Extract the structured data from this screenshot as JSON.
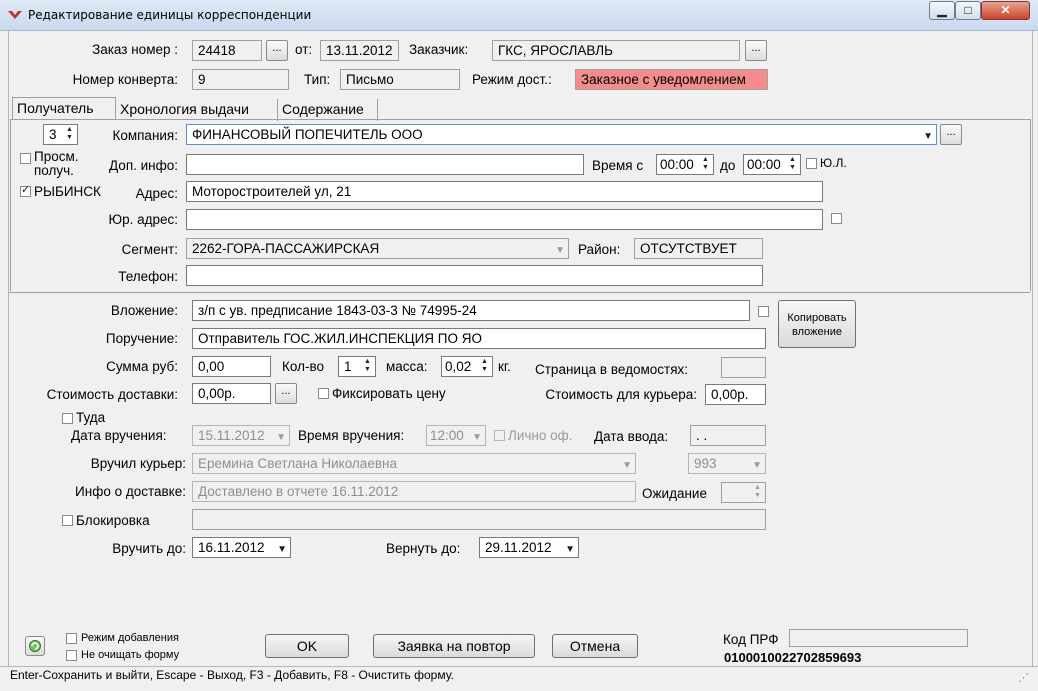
{
  "window": {
    "title": "Редактирование единицы корреспонденции",
    "min_glyph": "▁",
    "max_glyph": "□",
    "close_glyph": "✕"
  },
  "header": {
    "order_label": "Заказ номер :",
    "order_value": "24418",
    "from_label": "от:",
    "from_value": "13.11.2012",
    "customer_label": "Заказчик:",
    "customer_value": "ГКС, ЯРОСЛАВЛЬ",
    "envelope_label": "Номер конверта:",
    "envelope_value": "9",
    "type_label": "Тип:",
    "type_value": "Письмо",
    "delivery_mode_label": "Режим дост.:",
    "delivery_mode_value": "Заказное с уведомлением",
    "dots": "..."
  },
  "tabs": [
    "Получатель",
    "Хронология выдачи",
    "Содержание"
  ],
  "recipient": {
    "spin_value": "3",
    "company_label": "Компания:",
    "company_value": "ФИНАНСОВЫЙ ПОПЕЧИТЕЛЬ ООО",
    "view_label_1": "Просм.",
    "view_label_2": "получ.",
    "extra_info_label": "Доп. инфо:",
    "extra_info_value": "",
    "time_from_label": "Время с",
    "time_from_value": "00:00",
    "time_to_label": "до",
    "time_to_value": "00:00",
    "legal_label": "Ю.Л.",
    "city_label": "РЫБИНСК",
    "address_label": "Адрес:",
    "address_value": "Моторостроителей ул, 21",
    "legal_address_label": "Юр. адрес:",
    "legal_address_value": "",
    "segment_label": "Сегмент:",
    "segment_value": "2262-ГОРА-ПАССАЖИРСКАЯ",
    "district_label": "Район:",
    "district_value": "ОТСУТСТВУЕТ",
    "phone_label": "Телефон:",
    "phone_value": ""
  },
  "content": {
    "attachment_label": "Вложение:",
    "attachment_value": "з/п с ув. предписание 1843-03-3  № 74995-24",
    "copy_button_1": "Копировать",
    "copy_button_2": "вложение",
    "assignment_label": "Поручение:",
    "assignment_value": "Отправитель ГОС.ЖИЛ.ИНСПЕКЦИЯ ПО ЯО",
    "sum_label": "Сумма руб:",
    "sum_value": "0,00",
    "qty_label": "Кол-во",
    "qty_value": "1",
    "mass_label": "масса:",
    "mass_value": "0,02",
    "kg_label": "кг.",
    "sheet_page_label": "Страница в ведомостях:",
    "sheet_page_value": "",
    "delivery_cost_label": "Стоимость доставки:",
    "delivery_cost_value": "0,00р.",
    "fix_price_label": "Фиксировать цену",
    "courier_cost_label": "Стоимость для курьера:",
    "courier_cost_value": "0,00р.",
    "there_label": "Туда",
    "handover_date_label": "Дата вручения:",
    "handover_date_value": "15.11.2012",
    "handover_time_label": "Время вручения:",
    "handover_time_value": "12:00",
    "personal_label": "Лично оф.",
    "entry_date_label": "Дата ввода:",
    "entry_date_value": " .  .",
    "courier_label": "Вручил курьер:",
    "courier_value": "Еремина Светлана Николаевна",
    "courier_code": "993",
    "delivery_info_label": "Инфо о доставке:",
    "delivery_info_value": "Доставлено в отчете 16.11.2012",
    "waiting_label": "Ожидание",
    "block_label": "Блокировка",
    "deliver_by_label": "Вручить до:",
    "deliver_by_value": "16.11.2012",
    "return_by_label": "Вернуть до:",
    "return_by_value": "29.11.2012"
  },
  "footer": {
    "add_mode_label": "Режим добавления",
    "keep_form_label": "Не очищать форму",
    "ok_label": "OK",
    "repeat_label": "Заявка на повтор",
    "cancel_label": "Отмена",
    "prf_label": "Код ПРФ",
    "prf_value": "",
    "barcode": "0100010022702859693"
  },
  "status": {
    "text": "Enter-Сохранить и выйти, Escape - Выход, F3 - Добавить, F8 - Очистить форму."
  },
  "colors": {
    "delivery_mode_bg": "#f58c8c",
    "title_gradient_top": "#dfe9f5",
    "close_button": "#c7442b"
  }
}
